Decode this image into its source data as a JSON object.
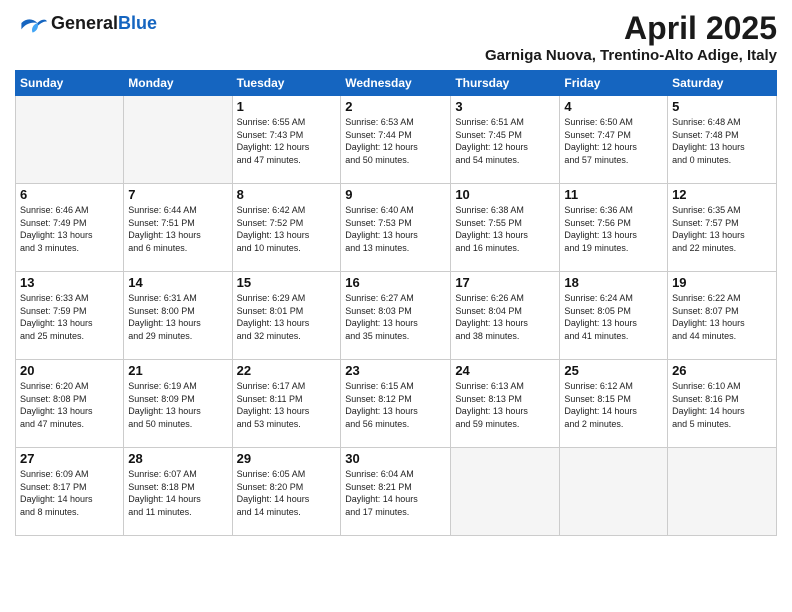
{
  "header": {
    "logo_line1": "General",
    "logo_line2": "Blue",
    "title": "April 2025",
    "subtitle": "Garniga Nuova, Trentino-Alto Adige, Italy"
  },
  "days_of_week": [
    "Sunday",
    "Monday",
    "Tuesday",
    "Wednesday",
    "Thursday",
    "Friday",
    "Saturday"
  ],
  "weeks": [
    [
      {
        "day": "",
        "info": ""
      },
      {
        "day": "",
        "info": ""
      },
      {
        "day": "1",
        "info": "Sunrise: 6:55 AM\nSunset: 7:43 PM\nDaylight: 12 hours\nand 47 minutes."
      },
      {
        "day": "2",
        "info": "Sunrise: 6:53 AM\nSunset: 7:44 PM\nDaylight: 12 hours\nand 50 minutes."
      },
      {
        "day": "3",
        "info": "Sunrise: 6:51 AM\nSunset: 7:45 PM\nDaylight: 12 hours\nand 54 minutes."
      },
      {
        "day": "4",
        "info": "Sunrise: 6:50 AM\nSunset: 7:47 PM\nDaylight: 12 hours\nand 57 minutes."
      },
      {
        "day": "5",
        "info": "Sunrise: 6:48 AM\nSunset: 7:48 PM\nDaylight: 13 hours\nand 0 minutes."
      }
    ],
    [
      {
        "day": "6",
        "info": "Sunrise: 6:46 AM\nSunset: 7:49 PM\nDaylight: 13 hours\nand 3 minutes."
      },
      {
        "day": "7",
        "info": "Sunrise: 6:44 AM\nSunset: 7:51 PM\nDaylight: 13 hours\nand 6 minutes."
      },
      {
        "day": "8",
        "info": "Sunrise: 6:42 AM\nSunset: 7:52 PM\nDaylight: 13 hours\nand 10 minutes."
      },
      {
        "day": "9",
        "info": "Sunrise: 6:40 AM\nSunset: 7:53 PM\nDaylight: 13 hours\nand 13 minutes."
      },
      {
        "day": "10",
        "info": "Sunrise: 6:38 AM\nSunset: 7:55 PM\nDaylight: 13 hours\nand 16 minutes."
      },
      {
        "day": "11",
        "info": "Sunrise: 6:36 AM\nSunset: 7:56 PM\nDaylight: 13 hours\nand 19 minutes."
      },
      {
        "day": "12",
        "info": "Sunrise: 6:35 AM\nSunset: 7:57 PM\nDaylight: 13 hours\nand 22 minutes."
      }
    ],
    [
      {
        "day": "13",
        "info": "Sunrise: 6:33 AM\nSunset: 7:59 PM\nDaylight: 13 hours\nand 25 minutes."
      },
      {
        "day": "14",
        "info": "Sunrise: 6:31 AM\nSunset: 8:00 PM\nDaylight: 13 hours\nand 29 minutes."
      },
      {
        "day": "15",
        "info": "Sunrise: 6:29 AM\nSunset: 8:01 PM\nDaylight: 13 hours\nand 32 minutes."
      },
      {
        "day": "16",
        "info": "Sunrise: 6:27 AM\nSunset: 8:03 PM\nDaylight: 13 hours\nand 35 minutes."
      },
      {
        "day": "17",
        "info": "Sunrise: 6:26 AM\nSunset: 8:04 PM\nDaylight: 13 hours\nand 38 minutes."
      },
      {
        "day": "18",
        "info": "Sunrise: 6:24 AM\nSunset: 8:05 PM\nDaylight: 13 hours\nand 41 minutes."
      },
      {
        "day": "19",
        "info": "Sunrise: 6:22 AM\nSunset: 8:07 PM\nDaylight: 13 hours\nand 44 minutes."
      }
    ],
    [
      {
        "day": "20",
        "info": "Sunrise: 6:20 AM\nSunset: 8:08 PM\nDaylight: 13 hours\nand 47 minutes."
      },
      {
        "day": "21",
        "info": "Sunrise: 6:19 AM\nSunset: 8:09 PM\nDaylight: 13 hours\nand 50 minutes."
      },
      {
        "day": "22",
        "info": "Sunrise: 6:17 AM\nSunset: 8:11 PM\nDaylight: 13 hours\nand 53 minutes."
      },
      {
        "day": "23",
        "info": "Sunrise: 6:15 AM\nSunset: 8:12 PM\nDaylight: 13 hours\nand 56 minutes."
      },
      {
        "day": "24",
        "info": "Sunrise: 6:13 AM\nSunset: 8:13 PM\nDaylight: 13 hours\nand 59 minutes."
      },
      {
        "day": "25",
        "info": "Sunrise: 6:12 AM\nSunset: 8:15 PM\nDaylight: 14 hours\nand 2 minutes."
      },
      {
        "day": "26",
        "info": "Sunrise: 6:10 AM\nSunset: 8:16 PM\nDaylight: 14 hours\nand 5 minutes."
      }
    ],
    [
      {
        "day": "27",
        "info": "Sunrise: 6:09 AM\nSunset: 8:17 PM\nDaylight: 14 hours\nand 8 minutes."
      },
      {
        "day": "28",
        "info": "Sunrise: 6:07 AM\nSunset: 8:18 PM\nDaylight: 14 hours\nand 11 minutes."
      },
      {
        "day": "29",
        "info": "Sunrise: 6:05 AM\nSunset: 8:20 PM\nDaylight: 14 hours\nand 14 minutes."
      },
      {
        "day": "30",
        "info": "Sunrise: 6:04 AM\nSunset: 8:21 PM\nDaylight: 14 hours\nand 17 minutes."
      },
      {
        "day": "",
        "info": ""
      },
      {
        "day": "",
        "info": ""
      },
      {
        "day": "",
        "info": ""
      }
    ]
  ]
}
